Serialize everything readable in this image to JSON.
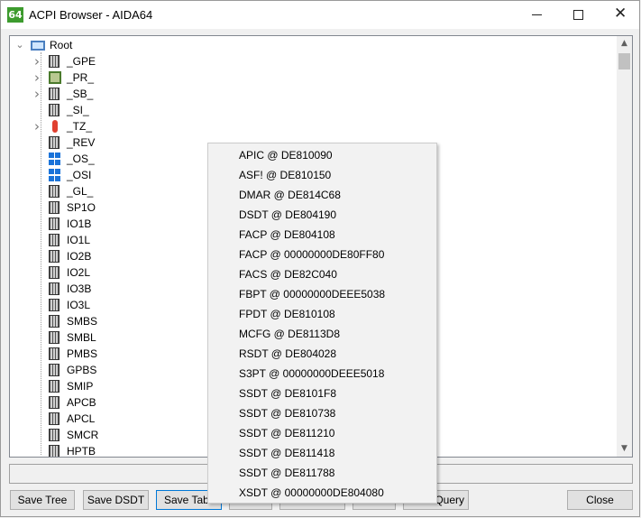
{
  "window": {
    "title": "ACPI Browser - AIDA64",
    "app_icon_text": "64"
  },
  "tree": {
    "root": {
      "label": "Root",
      "icon": "computer-icon"
    },
    "nodes": [
      {
        "label": "_GPE",
        "icon": "chip-icon",
        "expandable": true
      },
      {
        "label": "_PR_",
        "icon": "processor-icon",
        "expandable": true
      },
      {
        "label": "_SB_",
        "icon": "chip-icon",
        "expandable": true
      },
      {
        "label": "_SI_",
        "icon": "chip-icon",
        "expandable": false
      },
      {
        "label": "_TZ_",
        "icon": "thermometer-icon",
        "expandable": true
      },
      {
        "label": "_REV",
        "icon": "chip-icon",
        "expandable": false
      },
      {
        "label": "_OS_",
        "icon": "windows-icon",
        "expandable": false
      },
      {
        "label": "_OSI",
        "icon": "windows-icon",
        "expandable": false
      },
      {
        "label": "_GL_",
        "icon": "chip-icon",
        "expandable": false
      },
      {
        "label": "SP1O",
        "icon": "chip-icon",
        "expandable": false
      },
      {
        "label": "IO1B",
        "icon": "chip-icon",
        "expandable": false
      },
      {
        "label": "IO1L",
        "icon": "chip-icon",
        "expandable": false
      },
      {
        "label": "IO2B",
        "icon": "chip-icon",
        "expandable": false
      },
      {
        "label": "IO2L",
        "icon": "chip-icon",
        "expandable": false
      },
      {
        "label": "IO3B",
        "icon": "chip-icon",
        "expandable": false
      },
      {
        "label": "IO3L",
        "icon": "chip-icon",
        "expandable": false
      },
      {
        "label": "SMBS",
        "icon": "chip-icon",
        "expandable": false
      },
      {
        "label": "SMBL",
        "icon": "chip-icon",
        "expandable": false
      },
      {
        "label": "PMBS",
        "icon": "chip-icon",
        "expandable": false
      },
      {
        "label": "GPBS",
        "icon": "chip-icon",
        "expandable": false
      },
      {
        "label": "SMIP",
        "icon": "chip-icon",
        "expandable": false
      },
      {
        "label": "APCB",
        "icon": "chip-icon",
        "expandable": false
      },
      {
        "label": "APCL",
        "icon": "chip-icon",
        "expandable": false
      },
      {
        "label": "SMCR",
        "icon": "chip-icon",
        "expandable": false
      },
      {
        "label": "HPTB",
        "icon": "chip-icon",
        "expandable": false
      }
    ]
  },
  "popup_menu": {
    "items": [
      "APIC @ DE810090",
      "ASF! @ DE810150",
      "DMAR @ DE814C68",
      "DSDT @ DE804190",
      "FACP @ DE804108",
      "FACP @ 00000000DE80FF80",
      "FACS @ DE82C040",
      "FBPT @ 00000000DEEE5038",
      "FPDT @ DE810108",
      "MCFG @ DE8113D8",
      "RSDT @ DE804028",
      "S3PT @ 00000000DEEE5018",
      "SSDT @ DE8101F8",
      "SSDT @ DE810738",
      "SSDT @ DE811210",
      "SSDT @ DE811418",
      "SSDT @ DE811788",
      "XSDT @ 00000000DE804080"
    ]
  },
  "buttons": {
    "save_tree": "Save Tree",
    "save_dsdt": "Save DSDT",
    "save_table": "Save Tabl",
    "query": "Query",
    "close": "Close"
  }
}
